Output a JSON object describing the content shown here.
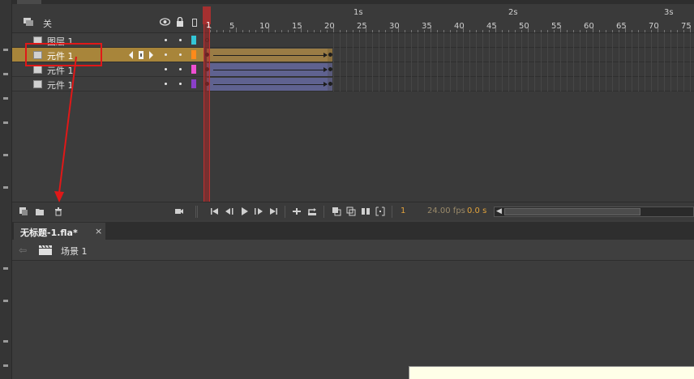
{
  "timeline": {
    "header_label": "关",
    "ruler": {
      "seconds": [
        "1s",
        "2s",
        "3s"
      ],
      "frames": [
        "1",
        "5",
        "10",
        "15",
        "20",
        "25",
        "30",
        "35",
        "40",
        "45",
        "50",
        "55",
        "60",
        "65",
        "70",
        "75"
      ]
    },
    "layers": [
      {
        "name": "图层 1",
        "selected": false,
        "color": "#33c6d6"
      },
      {
        "name": "元件 1",
        "selected": true,
        "color": "#ff8a1a"
      },
      {
        "name": "元件 1",
        "selected": false,
        "color": "#ee4fd2"
      },
      {
        "name": "元件 1",
        "selected": false,
        "color": "#8a3fc8"
      }
    ],
    "current_frame": "1",
    "fps": "24.00 fps",
    "time": "0.0 s"
  },
  "document": {
    "tab_title": "无标题-1.fla*",
    "close_label": "×",
    "scene_label": "场景 1"
  },
  "icons": {
    "new_layer": "new-layer-icon",
    "new_folder": "new-folder-icon",
    "delete": "trash-icon",
    "camera": "camera-icon"
  }
}
